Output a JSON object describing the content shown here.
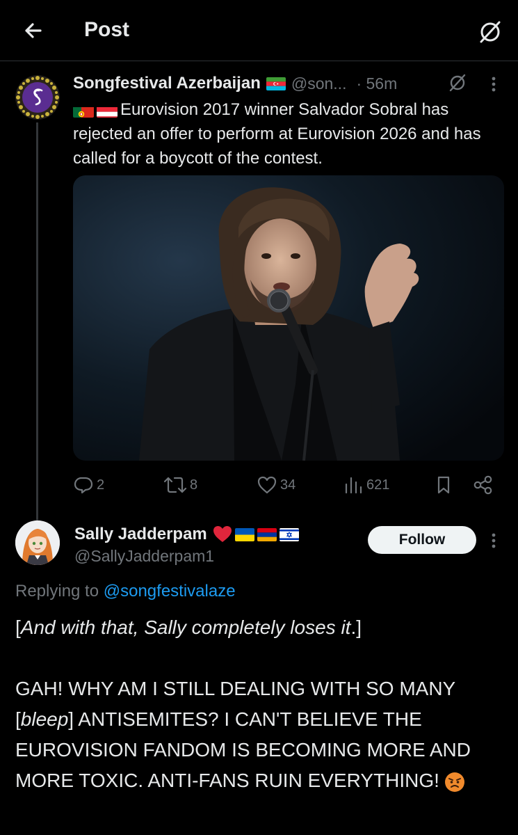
{
  "header": {
    "title": "Post",
    "back_icon": "arrow-left-icon",
    "grok_icon": "grok-icon"
  },
  "post": {
    "author_name": "Songfestival Azerbaijan",
    "author_flag": "azerbaijan-flag",
    "author_handle": "@son...",
    "time": "· 56m",
    "text_flags": [
      "portugal-flag",
      "austria-flag"
    ],
    "text": "Eurovision 2017 winner Salvador Sobral has rejected an offer to perform at Eurovision 2026 and has called for a boycott of the contest.",
    "media_icon": "singer-photo",
    "stats": {
      "replies": "2",
      "reposts": "8",
      "likes": "34",
      "views": "621"
    }
  },
  "reply": {
    "author_name": "Sally Jadderpam",
    "author_badges": [
      "red-heart-emoji",
      "ukraine-flag",
      "armenia-flag",
      "israel-flag"
    ],
    "author_handle": "@SallyJadderpam1",
    "follow_label": "Follow",
    "replying_prefix": "Replying to",
    "replying_mention": "@songfestivalaze",
    "line1_open": "[",
    "line1_italic": "And with that, Sally completely loses it",
    "line1_close": ".]",
    "line2_a": "GAH! WHY AM I STILL DEALING WITH SO MANY [",
    "line2_italic": "bleep",
    "line2_b": "] ANTISEMITES? I CAN'T BELIEVE THE EUROVISION FANDOM IS BECOMING MORE AND MORE TOXIC. ANTI-FANS RUIN EVERYTHING!",
    "end_emoji": "angry-face-emoji"
  },
  "colors": {
    "background": "#000000",
    "text": "#e7e9ea",
    "secondary": "#71767b",
    "link": "#1d9bf0",
    "follow_bg": "#eff3f4"
  }
}
